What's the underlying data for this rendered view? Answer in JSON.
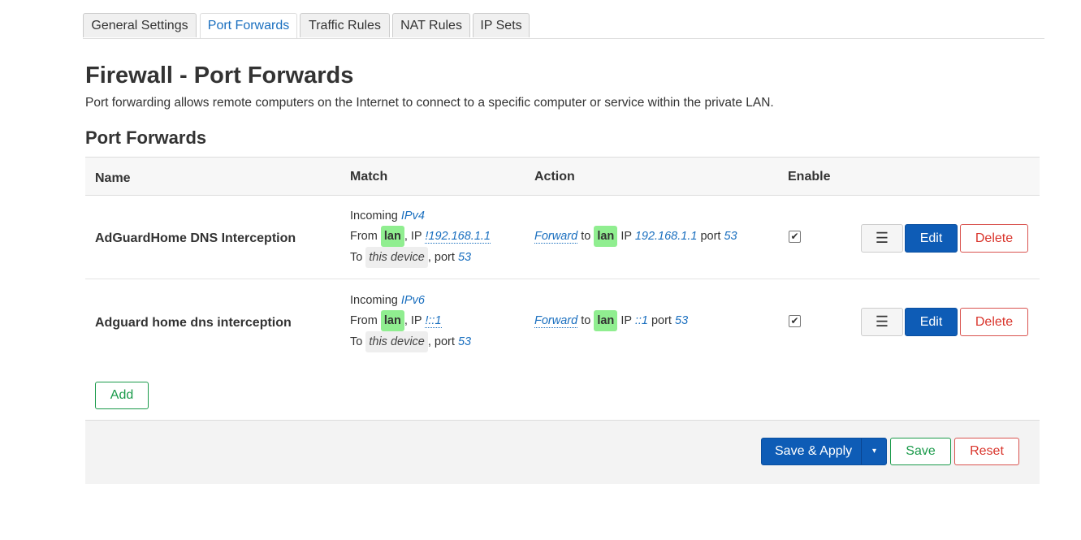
{
  "tabs": [
    {
      "label": "General Settings",
      "active": false
    },
    {
      "label": "Port Forwards",
      "active": true
    },
    {
      "label": "Traffic Rules",
      "active": false
    },
    {
      "label": "NAT Rules",
      "active": false
    },
    {
      "label": "IP Sets",
      "active": false
    }
  ],
  "page": {
    "title": "Firewall - Port Forwards",
    "description": "Port forwarding allows remote computers on the Internet to connect to a specific computer or service within the private LAN.",
    "section_title": "Port Forwards"
  },
  "table": {
    "headers": {
      "name": "Name",
      "match": "Match",
      "action": "Action",
      "enable": "Enable"
    },
    "rows": [
      {
        "name": "AdGuardHome DNS Interception",
        "match_incoming_label": "Incoming",
        "match_family": "IPv4",
        "match_from_label": "From",
        "match_zone": "lan",
        "match_ip_label": ", IP",
        "match_ip": "!192.168.1.1",
        "match_to_label": "To",
        "match_dest": "this device",
        "match_port_label": ", port",
        "match_port": "53",
        "action_forward": "Forward",
        "action_to": "to",
        "action_zone": "lan",
        "action_ip_label": "IP",
        "action_ip": "192.168.1.1",
        "action_port_label": "port",
        "action_port": "53",
        "enabled_mark": "✔",
        "menu_icon": "☰",
        "edit_label": "Edit",
        "delete_label": "Delete"
      },
      {
        "name": "Adguard home dns interception",
        "match_incoming_label": "Incoming",
        "match_family": "IPv6",
        "match_from_label": "From",
        "match_zone": "lan",
        "match_ip_label": ", IP",
        "match_ip": "!::1",
        "match_to_label": "To",
        "match_dest": "this device",
        "match_port_label": ", port",
        "match_port": "53",
        "action_forward": "Forward",
        "action_to": "to",
        "action_zone": "lan",
        "action_ip_label": "IP",
        "action_ip": "::1",
        "action_port_label": "port",
        "action_port": "53",
        "enabled_mark": "✔",
        "menu_icon": "☰",
        "edit_label": "Edit",
        "delete_label": "Delete"
      }
    ]
  },
  "actions": {
    "add_label": "Add",
    "save_apply_label": "Save & Apply",
    "dropdown_icon": "▾",
    "save_label": "Save",
    "reset_label": "Reset"
  },
  "colors": {
    "accent": "#1a6fbf",
    "primary_button": "#0e5cb6",
    "positive": "#1a9a4a",
    "negative": "#d9342b",
    "zone_lan": "#90ee90"
  }
}
